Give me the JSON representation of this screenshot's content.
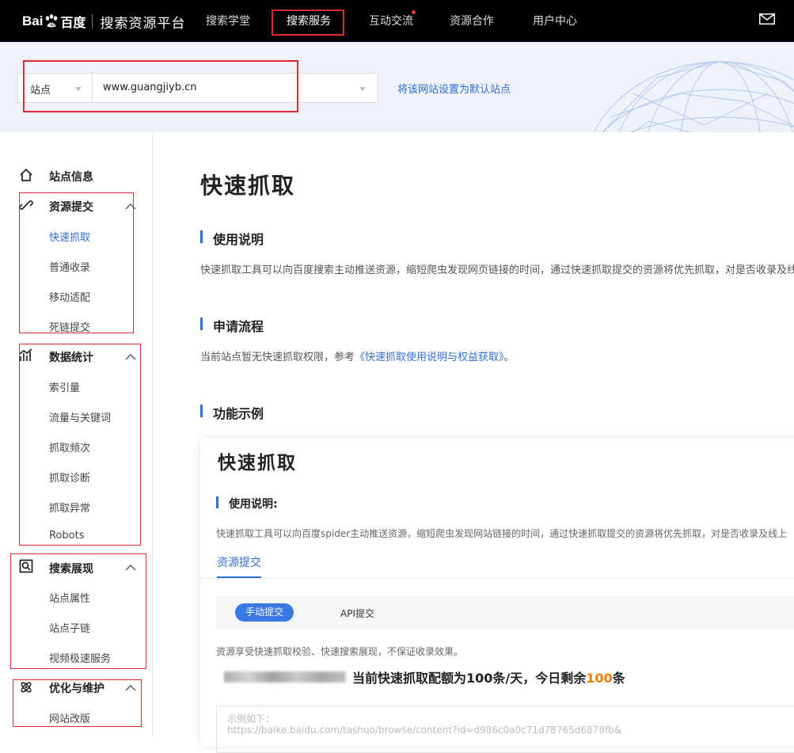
{
  "header": {
    "logo_bai": "Bai",
    "logo_du": "百度",
    "platform_title": "搜索资源平台",
    "nav": [
      {
        "label": "搜索学堂",
        "dot": false
      },
      {
        "label": "搜索服务",
        "dot": false,
        "active": true
      },
      {
        "label": "互动交流",
        "dot": true
      },
      {
        "label": "资源合作",
        "dot": false
      },
      {
        "label": "用户中心",
        "dot": false
      }
    ],
    "mail_icon": "mail-icon"
  },
  "banner": {
    "site_type": "站点",
    "site_url": "www.guangjiyb.cn",
    "set_default_link": "将该网站设置为默认站点"
  },
  "sidebar": {
    "site_info": "站点信息",
    "groups": [
      {
        "title": "资源提交",
        "icon": "link-icon",
        "items": [
          "快速抓取",
          "普通收录",
          "移动适配",
          "死链提交"
        ]
      },
      {
        "title": "数据统计",
        "icon": "chart-icon",
        "items": [
          "索引量",
          "流量与关键词",
          "抓取频次",
          "抓取诊断",
          "抓取异常",
          "Robots"
        ]
      },
      {
        "title": "搜索展现",
        "icon": "search-view-icon",
        "items": [
          "站点属性",
          "站点子链",
          "视频极速服务"
        ]
      },
      {
        "title": "优化与维护",
        "icon": "atom-icon",
        "items": [
          "网站改版"
        ]
      }
    ]
  },
  "main": {
    "title": "快速抓取",
    "usage_title": "使用说明",
    "usage_text": "快速抓取工具可以向百度搜索主动推送资源，缩短爬虫发现网页链接的时间，通过快速抓取提交的资源将优先抓取，对是否收录及线",
    "apply_title": "申请流程",
    "apply_text_prefix": "当前站点暂无快速抓取权限，参考",
    "apply_link": "《快速抓取使用说明与权益获取》",
    "apply_text_suffix": "。",
    "example_title": "功能示例"
  },
  "example": {
    "title": "快速抓取",
    "usage_title": "使用说明:",
    "usage_text": "快速抓取工具可以向百度spider主动推送资源，缩短爬虫发现网站链接的时间，通过快速抓取提交的资源将优先抓取，对是否收录及线上",
    "tab": "资源提交",
    "manual_tab": "手动提交",
    "api_tab": "API提交",
    "note": "资源享受快速抓取校验、快速搜索展现，不保证收录效果。",
    "quota_prefix": "当前快速抓取配额为",
    "quota_total": "100",
    "quota_mid": "条/天，今日剩余",
    "quota_left": "100",
    "quota_suffix": "条",
    "textarea_line1": "示例如下：",
    "textarea_line2": "https://baike.baidu.com/tashuo/browse/content?id=d986c0a0c71d78765d6878fb&"
  }
}
